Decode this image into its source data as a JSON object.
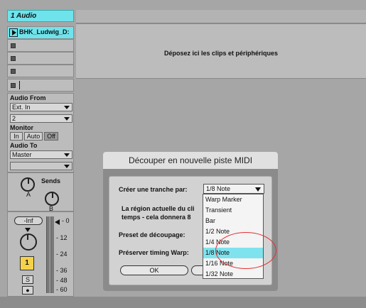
{
  "track": {
    "name": "1 Audio",
    "clip_name": "BHK_Ludwig_D:",
    "audio_from_label": "Audio From",
    "audio_from_value": "Ext. In",
    "channel_value": "2",
    "monitor_label": "Monitor",
    "monitor_options": [
      "In",
      "Auto",
      "Off"
    ],
    "audio_to_label": "Audio To",
    "audio_to_value": "Master",
    "sends_label": "Sends",
    "send_a": "A",
    "send_b": "B",
    "volume_value": "-Inf",
    "track_number": "1",
    "solo_label": "S",
    "arm_label": "●",
    "db_scale": [
      "0",
      "12",
      "24",
      "36",
      "48",
      "60"
    ]
  },
  "main": {
    "drop_text": "Déposez ici les clips et périphériques"
  },
  "dialog": {
    "title": "Découper en nouvelle piste MIDI",
    "slice_label": "Créer une tranche par:",
    "slice_value": "1/8 Note",
    "description_line1": "La région actuelle du cli",
    "description_line2": "temps - cela donnera 8",
    "preset_label": "Preset de découpage:",
    "warp_label": "Préserver timing Warp:",
    "ok_label": "OK"
  },
  "menu": {
    "items": [
      "Warp Marker",
      "Transient",
      "Bar",
      "1/2 Note",
      "1/4 Note",
      "1/8 Note",
      "1/16 Note",
      "1/32 Note"
    ],
    "selected": "1/8 Note"
  },
  "colors": {
    "accent": "#6fe3ec",
    "highlight": "#7fe3ee",
    "annotation": "#e03030",
    "track_number_bg": "#f6d24a"
  }
}
